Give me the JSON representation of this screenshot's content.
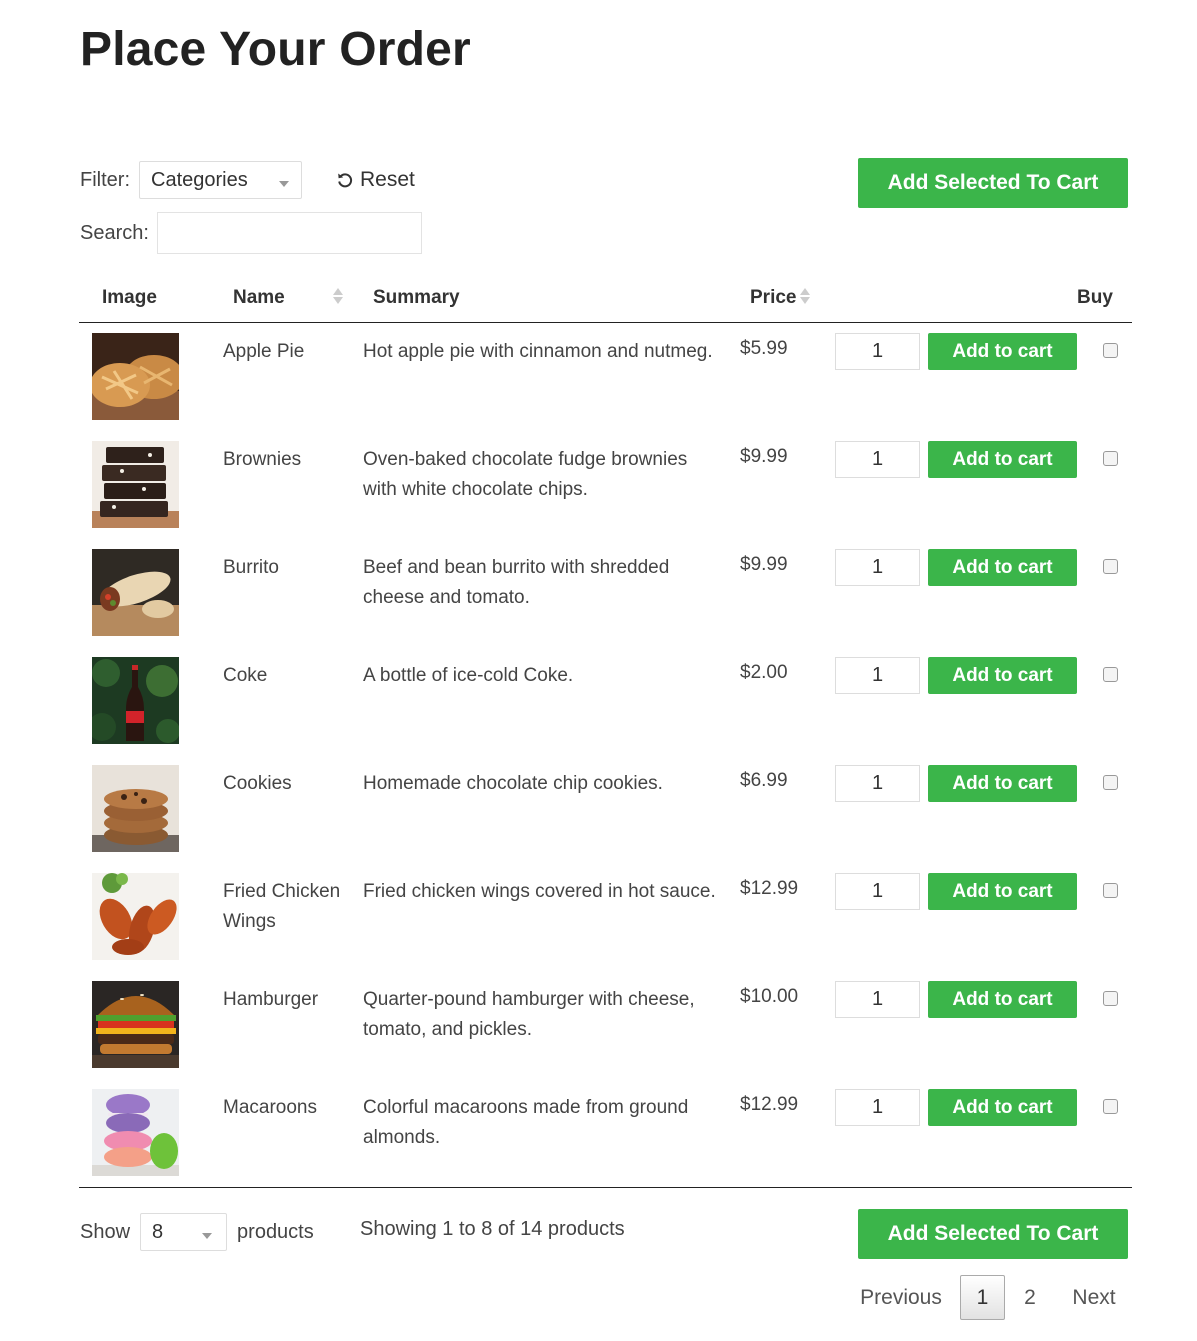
{
  "page": {
    "title": "Place Your Order"
  },
  "filter": {
    "label": "Filter:",
    "selected": "Categories",
    "reset_label": "Reset"
  },
  "search": {
    "label": "Search:",
    "value": "",
    "placeholder": ""
  },
  "actions": {
    "add_selected_label": "Add Selected To Cart",
    "add_to_cart_label": "Add to cart"
  },
  "columns": {
    "image": "Image",
    "name": "Name",
    "summary": "Summary",
    "price": "Price",
    "buy": "Buy"
  },
  "products": [
    {
      "name": "Apple Pie",
      "summary": "Hot apple pie with cinnamon and nutmeg.",
      "price": "$5.99",
      "qty": "1",
      "checked": false,
      "image_icon": "apple-pie-photo"
    },
    {
      "name": "Brownies",
      "summary": "Oven-baked chocolate fudge brownies with white chocolate chips.",
      "price": "$9.99",
      "qty": "1",
      "checked": false,
      "image_icon": "brownies-photo"
    },
    {
      "name": "Burrito",
      "summary": "Beef and bean burrito with shredded cheese and tomato.",
      "price": "$9.99",
      "qty": "1",
      "checked": false,
      "image_icon": "burrito-photo"
    },
    {
      "name": "Coke",
      "summary": "A bottle of ice-cold Coke.",
      "price": "$2.00",
      "qty": "1",
      "checked": false,
      "image_icon": "coke-photo"
    },
    {
      "name": "Cookies",
      "summary": "Homemade chocolate chip cookies.",
      "price": "$6.99",
      "qty": "1",
      "checked": false,
      "image_icon": "cookies-photo"
    },
    {
      "name": "Fried Chicken Wings",
      "summary": "Fried chicken wings covered in hot sauce.",
      "price": "$12.99",
      "qty": "1",
      "checked": false,
      "image_icon": "chicken-wings-photo"
    },
    {
      "name": "Hamburger",
      "summary": "Quarter-pound hamburger with cheese, tomato, and pickles.",
      "price": "$10.00",
      "qty": "1",
      "checked": false,
      "image_icon": "hamburger-photo"
    },
    {
      "name": "Macaroons",
      "summary": "Colorful macaroons made from ground almonds.",
      "price": "$12.99",
      "qty": "1",
      "checked": false,
      "image_icon": "macaroons-photo"
    }
  ],
  "footer": {
    "show_label": "Show",
    "show_value": "8",
    "products_label": "products",
    "showing_text": "Showing 1 to 8 of 14 products"
  },
  "pagination": {
    "previous": "Previous",
    "pages": [
      "1",
      "2"
    ],
    "current": "1",
    "next": "Next"
  },
  "colors": {
    "accent_green": "#3bb54a",
    "text": "#333333"
  }
}
